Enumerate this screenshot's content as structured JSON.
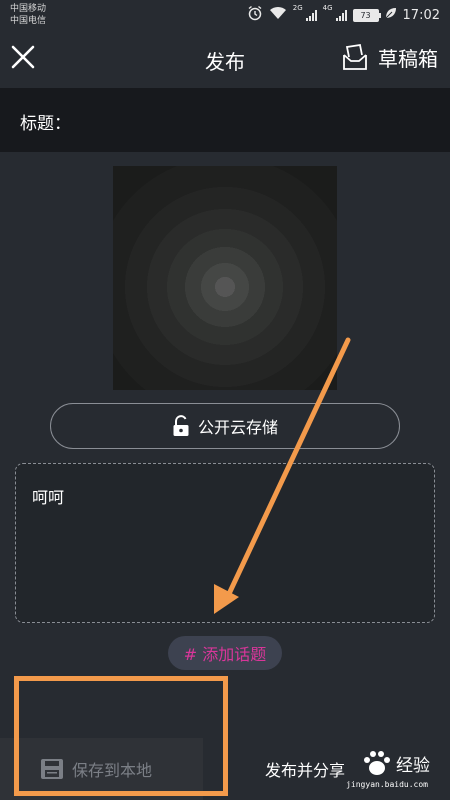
{
  "status_bar": {
    "carrier_1": "中国移动",
    "carrier_2": "中国电信",
    "network_1": "2G",
    "network_2": "4G",
    "battery": "73",
    "time": "17:02"
  },
  "header": {
    "title": "发布",
    "drafts_label": "草稿箱"
  },
  "title_field": {
    "label": "标题：",
    "value": ""
  },
  "cloud_storage": {
    "label": "公开云存储"
  },
  "description": {
    "text": "呵呵"
  },
  "topic": {
    "label": "# 添加话题"
  },
  "bottom": {
    "save_label": "保存到本地",
    "publish_label": "发布并分享"
  },
  "watermark": {
    "brand": "经验",
    "url": "jingyan.baidu.com"
  },
  "colors": {
    "background": "#272b31",
    "title_bar": "#17191d",
    "accent_topic": "#d9369a",
    "annotation": "#f39a4b"
  },
  "icons": {
    "close": "close-icon",
    "drafts": "draft-box-icon",
    "lock": "unlock-icon",
    "save": "floppy-disk-icon"
  }
}
